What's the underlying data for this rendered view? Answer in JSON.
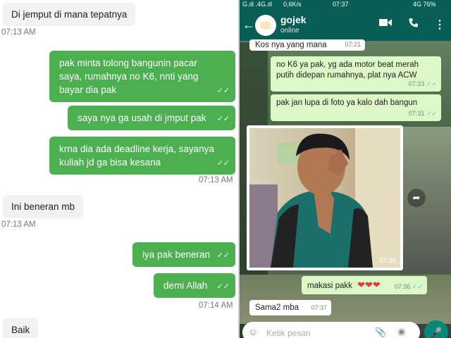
{
  "left_chat": {
    "messages": [
      {
        "text": "Di jemput di mana tepatnya",
        "time": "07:13 AM"
      },
      {
        "text": "pak minta tolong bangunin pacar saya, rumahnya no K6, nnti yang bayar dia pak"
      },
      {
        "text": "saya nya ga usah di jmput pak"
      },
      {
        "text": "krna dia ada deadline kerja, sayanya kuliah jd ga bisa kesana",
        "time": "07:13 AM"
      },
      {
        "text": "Ini beneran mb",
        "time": "07:13 AM"
      },
      {
        "text": "iya pak beneran"
      },
      {
        "text": "demi Allah",
        "time": "07:14 AM"
      },
      {
        "text": "Baik"
      }
    ]
  },
  "right_chat": {
    "status_bar": {
      "signal": "G.ıll .4G.ıll",
      "speed": "0,6K/s",
      "clock": "07:37",
      "battery": "4G 76%"
    },
    "header": {
      "name": "gojek",
      "subtitle": "online"
    },
    "messages": [
      {
        "text": "Kos nya yang mana",
        "time": "07:21"
      },
      {
        "text": "no K6 ya pak, yg ada motor beat merah putih didepan rumahnya, plat nya ACW",
        "time": "07:23"
      },
      {
        "text": "pak jan lupa di foto ya kalo dah bangun",
        "time": "07:31"
      },
      {
        "image_time": "07:36"
      },
      {
        "text": "makasi pakk",
        "emoji": "❤❤❤",
        "time": "07:36"
      },
      {
        "text": "Sama2 mba",
        "time": "07:37"
      }
    ],
    "input": {
      "placeholder": "Ketik pesan"
    }
  }
}
